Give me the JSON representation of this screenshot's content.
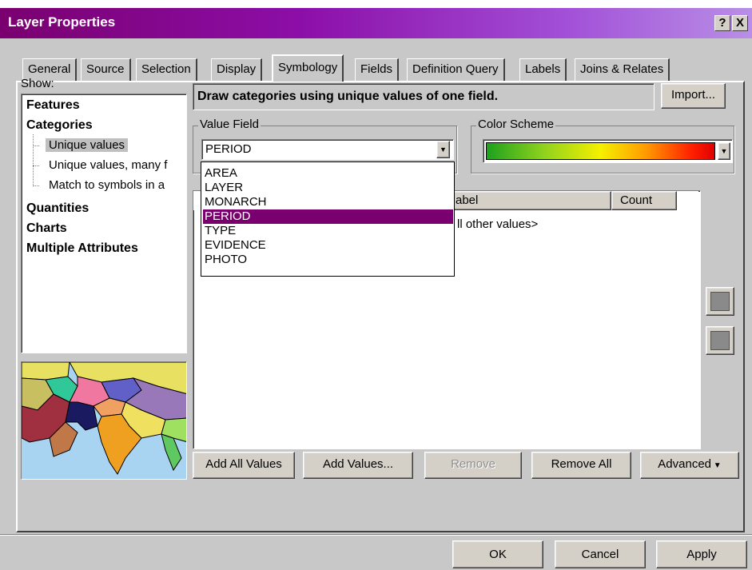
{
  "window": {
    "title": "Layer Properties",
    "help_btn": "?",
    "close_btn": "X"
  },
  "tabs": [
    {
      "label": "General"
    },
    {
      "label": "Source"
    },
    {
      "label": "Selection"
    },
    {
      "label": "Display"
    },
    {
      "label": "Symbology",
      "active": true
    },
    {
      "label": "Fields"
    },
    {
      "label": "Definition Query"
    },
    {
      "label": "Labels"
    },
    {
      "label": "Joins & Relates"
    }
  ],
  "show": {
    "label": "Show:",
    "items": [
      {
        "label": "Features"
      },
      {
        "label": "Categories"
      },
      {
        "label": "Unique values",
        "selected": true
      },
      {
        "label": "Unique values, many f"
      },
      {
        "label": "Match to symbols in a"
      },
      {
        "label": "Quantities"
      },
      {
        "label": "Charts"
      },
      {
        "label": "Multiple Attributes"
      }
    ]
  },
  "heading": "Draw categories using unique values of one field.",
  "import_button": "Import...",
  "value_field": {
    "label": "Value Field",
    "selected": "PERIOD",
    "options": [
      "AREA",
      "LAYER",
      "MONARCH",
      "PERIOD",
      "TYPE",
      "EVIDENCE",
      "PHOTO"
    ]
  },
  "color_scheme": {
    "label": "Color Scheme",
    "gradient": [
      "#1ea01e",
      "#8fd21e",
      "#f5f000",
      "#ff9a00",
      "#ff2000",
      "#e00000"
    ]
  },
  "table": {
    "headers": {
      "label": "abel",
      "count": "Count"
    },
    "row": "ll other values>"
  },
  "buttons": {
    "add_all": "Add All Values",
    "add_values": "Add Values...",
    "remove": "Remove",
    "remove_all": "Remove All",
    "advanced": "Advanced"
  },
  "footer": {
    "ok": "OK",
    "cancel": "Cancel",
    "apply": "Apply"
  },
  "colors": {
    "selection": "#7a006f",
    "title_start": "#7a006f",
    "title_end": "#b88fe6"
  }
}
